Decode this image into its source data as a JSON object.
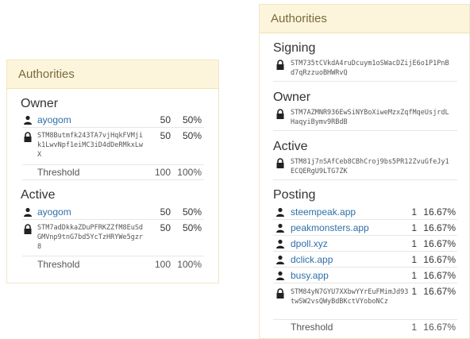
{
  "left_panel": {
    "title": "Authorities",
    "owner": {
      "title": "Owner",
      "rows": [
        {
          "icon": "user-icon",
          "name": "ayogom",
          "weight": "50",
          "pct": "50%"
        },
        {
          "icon": "lock-icon",
          "key": "STM8Butmfk243TA7vjHqkFVMjik1LwvNpf1eiMC3iD4dDeRMkxLwX",
          "weight": "50",
          "pct": "50%"
        }
      ],
      "threshold": {
        "label": "Threshold",
        "value": "100",
        "pct": "100%"
      }
    },
    "active": {
      "title": "Active",
      "rows": [
        {
          "icon": "user-icon",
          "name": "ayogom",
          "weight": "50",
          "pct": "50%"
        },
        {
          "icon": "lock-icon",
          "key": "STM7adDkkaZDuPFRKZZfM8EuSdGMVnp9tnG7bd5YcTzHRYWe5gzr8",
          "weight": "50",
          "pct": "50%"
        }
      ],
      "threshold": {
        "label": "Threshold",
        "value": "100",
        "pct": "100%"
      }
    }
  },
  "right_panel": {
    "title": "Authorities",
    "signing": {
      "title": "Signing",
      "key": "STM735tCVkdA4ruDcuym1oSWacDZijE6o1P1PnBd7qRzzuoBHWRvQ"
    },
    "owner": {
      "title": "Owner",
      "key": "STM7AZMNR936EwSiNYBoXiweMzxZqfMqeUsjrdLHaqyiBymv9RBdB"
    },
    "active": {
      "title": "Active",
      "key": "STM81j7nSAfCeb8CBhCroj9bs5PR12ZvuGfeJy1ECQERgU9LTG7ZK"
    },
    "posting": {
      "title": "Posting",
      "rows": [
        {
          "name": "steempeak.app",
          "weight": "1",
          "pct": "16.67%"
        },
        {
          "name": "peakmonsters.app",
          "weight": "1",
          "pct": "16.67%"
        },
        {
          "name": "dpoll.xyz",
          "weight": "1",
          "pct": "16.67%"
        },
        {
          "name": "dclick.app",
          "weight": "1",
          "pct": "16.67%"
        },
        {
          "name": "busy.app",
          "weight": "1",
          "pct": "16.67%"
        }
      ],
      "key_row": {
        "key": "STM84yN7GYU7XXbwYYrEuFMimJd93twSW2vsQWyBdBKctVYoboNCz",
        "weight": "1",
        "pct": "16.67%"
      },
      "threshold": {
        "label": "Threshold",
        "value": "1",
        "pct": "16.67%"
      }
    }
  }
}
